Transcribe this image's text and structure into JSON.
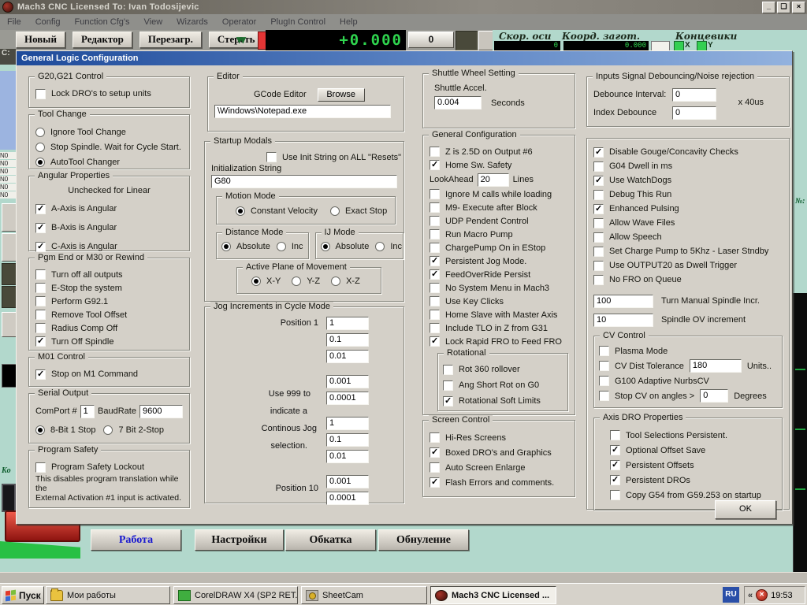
{
  "window": {
    "title": "Mach3 CNC  Licensed To: Ivan Todosijevic",
    "menu": [
      "File",
      "Config",
      "Function Cfg's",
      "View",
      "Wizards",
      "Operator",
      "PlugIn Control",
      "Help"
    ],
    "buttons": {
      "minimize": "_",
      "restore": "❏",
      "close": "×"
    }
  },
  "toolbar": {
    "buttons": [
      "Новый",
      "Редактор",
      "Перезагр.",
      "Стереть"
    ],
    "arrow_glyph": "▾▾",
    "dro_value": "+0.000",
    "zero_value": "0",
    "labels": {
      "axis_speed": "Скор. оси",
      "work_coords": "Коорд. загот.",
      "limits": "Концевики"
    },
    "mini_dro1": "0",
    "mini_dro2": "0.000",
    "axis_x": "X",
    "axis_y": "Y"
  },
  "fragments": {
    "drive": "C:",
    "lines": [
      "N0",
      "N0",
      "N0",
      "N0",
      "N0",
      "N0"
    ],
    "comment": "Ko",
    "num": "№:"
  },
  "dialog": {
    "title": "General Logic Configuration",
    "ok_label": "OK",
    "g20": {
      "title": "G20,G21 Control",
      "items": [
        {
          "label": "Lock DRO's to setup units",
          "checked": false
        }
      ]
    },
    "tool_change": {
      "title": "Tool Change",
      "items": [
        {
          "label": "Ignore Tool Change",
          "selected": false
        },
        {
          "label": "Stop Spindle. Wait for Cycle Start.",
          "selected": false
        },
        {
          "label": "AutoTool Changer",
          "selected": true
        }
      ]
    },
    "angular": {
      "title": "Angular Properties",
      "note": "Unchecked for Linear",
      "items": [
        {
          "label": "A-Axis is Angular",
          "checked": true
        },
        {
          "label": "B-Axis is Angular",
          "checked": true
        },
        {
          "label": "C-Axis is Angular",
          "checked": true
        }
      ]
    },
    "pgm_end": {
      "title": "Pgm End or M30 or Rewind",
      "items": [
        {
          "label": "Turn off all outputs",
          "checked": false
        },
        {
          "label": "E-Stop the system",
          "checked": false
        },
        {
          "label": "Perform G92.1",
          "checked": false
        },
        {
          "label": "Remove Tool Offset",
          "checked": false
        },
        {
          "label": "Radius Comp Off",
          "checked": false
        },
        {
          "label": "Turn Off Spindle",
          "checked": true
        }
      ]
    },
    "m01": {
      "title": "M01 Control",
      "items": [
        {
          "label": "Stop on M1 Command",
          "checked": true
        }
      ]
    },
    "serial": {
      "title": "Serial Output",
      "comport_label": "ComPort #",
      "comport_value": "1",
      "baud_label": "BaudRate",
      "baud_value": "9600",
      "radios": [
        {
          "label": "8-Bit 1 Stop",
          "selected": true
        },
        {
          "label": "7 Bit 2-Stop",
          "selected": false
        }
      ]
    },
    "program_safety": {
      "title": "Program Safety",
      "items": [
        {
          "label": "Program Safety Lockout",
          "checked": false
        }
      ],
      "note1": "This disables program translation while the",
      "note2": "External Activation #1 input is activated."
    },
    "editor": {
      "title": "Editor",
      "gcode_label": "GCode Editor",
      "browse_label": "Browse",
      "path": "\\Windows\\Notepad.exe"
    },
    "startup": {
      "title": "Startup Modals",
      "init_check": {
        "label": "Use Init String on ALL  \"Resets\"",
        "checked": false
      },
      "init_label": "Initialization String",
      "init_value": "G80",
      "motion": {
        "title": "Motion Mode",
        "items": [
          {
            "label": "Constant Velocity",
            "selected": true
          },
          {
            "label": "Exact Stop",
            "selected": false
          }
        ]
      },
      "distance": {
        "title": "Distance Mode",
        "items": [
          {
            "label": "Absolute",
            "selected": true
          },
          {
            "label": "Inc",
            "selected": false
          }
        ]
      },
      "ij": {
        "title": "IJ Mode",
        "items": [
          {
            "label": "Absolute",
            "selected": true
          },
          {
            "label": "Inc",
            "selected": false
          }
        ]
      },
      "plane": {
        "title": "Active Plane of Movement",
        "items": [
          {
            "label": "X-Y",
            "selected": true
          },
          {
            "label": "Y-Z",
            "selected": false
          },
          {
            "label": "X-Z",
            "selected": false
          }
        ]
      }
    },
    "jog": {
      "title": "Jog Increments in Cycle Mode",
      "pos1_label": "Position 1",
      "pos10_label": "Position 10",
      "note_lines": [
        "Use 999 to",
        "indicate a",
        "Continous Jog",
        "selection."
      ],
      "values": [
        "1",
        "0.1",
        "0.01",
        "0.001",
        "0.0001",
        "1",
        "0.1",
        "0.01",
        "0.001",
        "0.0001"
      ]
    },
    "shuttle": {
      "title": "Shuttle Wheel Setting",
      "accel_label": "Shuttle Accel.",
      "accel_value": "0.004",
      "unit": "Seconds"
    },
    "general": {
      "title": "General Configuration",
      "items_top": [
        {
          "label": "Z is 2.5D on Output #6",
          "checked": false
        },
        {
          "label": "Home Sw. Safety",
          "checked": true
        }
      ],
      "lookahead_label": "LookAhead",
      "lookahead_value": "20",
      "lookahead_unit": "Lines",
      "items": [
        {
          "label": "Ignore M calls while loading",
          "checked": false
        },
        {
          "label": "M9- Execute after Block",
          "checked": false
        },
        {
          "label": "UDP Pendent Control",
          "checked": false
        },
        {
          "label": "Run Macro Pump",
          "checked": false
        },
        {
          "label": "ChargePump On in EStop",
          "checked": false
        },
        {
          "label": "Persistent Jog Mode.",
          "checked": true
        },
        {
          "label": "FeedOverRide Persist",
          "checked": true
        },
        {
          "label": "No System Menu in Mach3",
          "checked": false
        },
        {
          "label": "Use Key Clicks",
          "checked": false
        },
        {
          "label": "Home Slave with Master Axis",
          "checked": false
        },
        {
          "label": "Include TLO in Z from G31",
          "checked": false
        },
        {
          "label": "Lock Rapid FRO to Feed FRO",
          "checked": true
        }
      ],
      "rotational": {
        "title": "Rotational",
        "items": [
          {
            "label": "Rot 360 rollover",
            "checked": false
          },
          {
            "label": "Ang Short Rot on G0",
            "checked": false
          },
          {
            "label": "Rotational Soft Limits",
            "checked": true
          }
        ]
      }
    },
    "screen_control": {
      "title": "Screen Control",
      "items": [
        {
          "label": "Hi-Res Screens",
          "checked": false
        },
        {
          "label": "Boxed DRO's and Graphics",
          "checked": true
        },
        {
          "label": "Auto Screen Enlarge",
          "checked": false
        },
        {
          "label": "Flash Errors and comments.",
          "checked": true
        }
      ]
    },
    "debounce": {
      "title": "Inputs Signal Debouncing/Noise rejection",
      "interval_label": "Debounce Interval:",
      "interval_value": "0",
      "unit": "x 40us",
      "index_label": "Index Debounce",
      "index_value": "0"
    },
    "right_list": {
      "items": [
        {
          "label": "Disable Gouge/Concavity Checks",
          "checked": true
        },
        {
          "label": "G04 Dwell in ms",
          "checked": false
        },
        {
          "label": "Use WatchDogs",
          "checked": true
        },
        {
          "label": "Debug This Run",
          "checked": false
        },
        {
          "label": "Enhanced Pulsing",
          "checked": true
        },
        {
          "label": "Allow Wave Files",
          "checked": false
        },
        {
          "label": "Allow Speech",
          "checked": false
        },
        {
          "label": "Set Charge Pump to 5Khz  - Laser Stndby",
          "checked": false
        },
        {
          "label": "Use OUTPUT20 as Dwell Trigger",
          "checked": false
        },
        {
          "label": "No FRO on Queue",
          "checked": false
        }
      ],
      "spindle_incr_value": "100",
      "spindle_incr_label": "Turn Manual Spindle Incr.",
      "spindle_ov_value": "10",
      "spindle_ov_label": "Spindle OV increment"
    },
    "cv": {
      "title": "CV Control",
      "plasma": {
        "label": "Plasma Mode"
      },
      "dist_label": "CV Dist Tolerance",
      "dist_value": "180",
      "dist_unit": "Units..",
      "nurbs_label": "G100 Adaptive NurbsCV",
      "stop_label": "Stop CV on angles >",
      "stop_value": "0",
      "stop_unit": "Degrees"
    },
    "axis_dro": {
      "title": "Axis DRO Properties",
      "items": [
        {
          "label": "Tool Selections Persistent.",
          "checked": false
        },
        {
          "label": "Optional Offset Save",
          "checked": true
        },
        {
          "label": "Persistent Offsets",
          "checked": true
        },
        {
          "label": "Persistent DROs",
          "checked": true
        },
        {
          "label": "Copy G54 from G59.253 on startup",
          "checked": false
        }
      ]
    }
  },
  "tabs": [
    {
      "label": "Работа",
      "active": true
    },
    {
      "label": "Настройки",
      "active": false
    },
    {
      "label": "Обкатка",
      "active": false
    },
    {
      "label": "Обнуление",
      "active": false
    }
  ],
  "taskbar": {
    "start_label": "Пуск",
    "buttons": [
      {
        "label": "Мои работы",
        "icon": "folder",
        "active": false
      },
      {
        "label": "CorelDRAW X4 (SP2 RET...",
        "icon": "coreldraw",
        "active": false
      },
      {
        "label": "SheetCam",
        "icon": "sheetcam",
        "active": false
      },
      {
        "label": "Mach3 CNC  Licensed ...",
        "icon": "mach3",
        "active": true
      }
    ],
    "tray": {
      "lang": "RU",
      "chevron": "«",
      "clock": "19:53"
    }
  }
}
